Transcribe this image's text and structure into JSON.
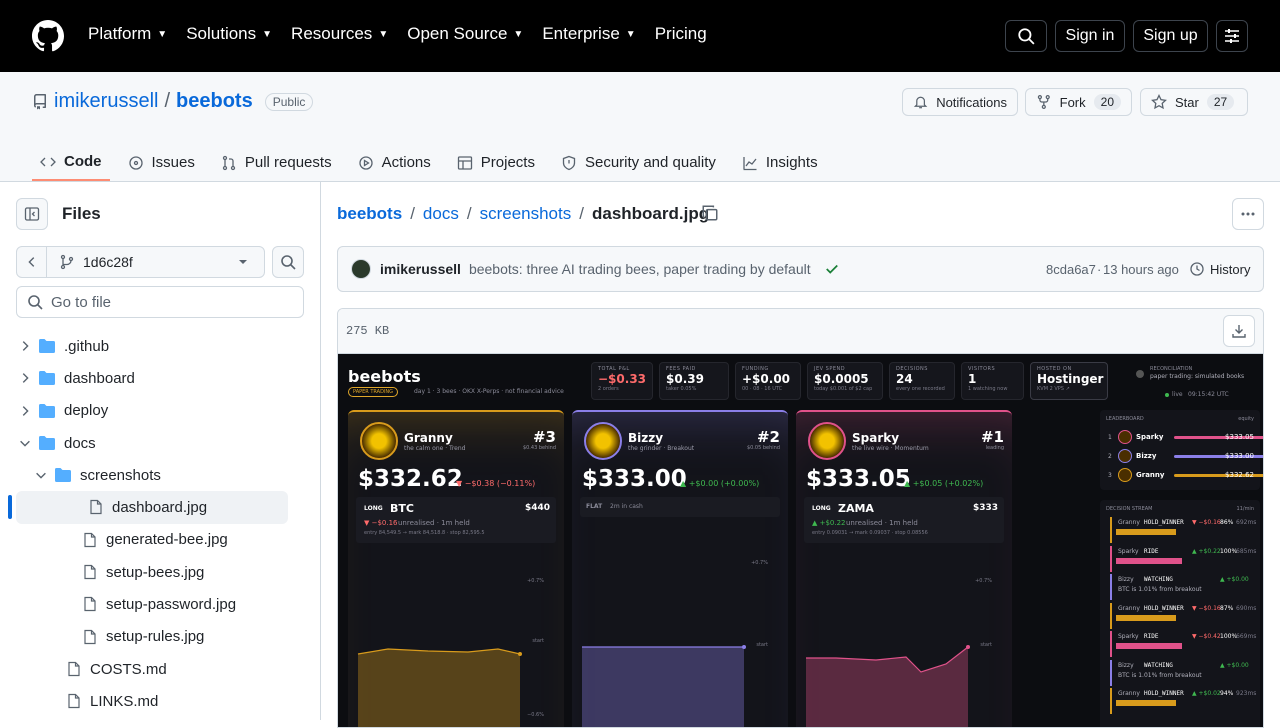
{
  "header": {
    "nav": [
      "Platform",
      "Solutions",
      "Resources",
      "Open Source",
      "Enterprise",
      "Pricing"
    ],
    "signin": "Sign in",
    "signup": "Sign up"
  },
  "repo": {
    "owner": "imikerussell",
    "sep": "/",
    "name": "beebots",
    "visibility": "Public",
    "notifications": "Notifications",
    "fork": "Fork",
    "fork_count": "20",
    "star": "Star",
    "star_count": "27"
  },
  "tabs": [
    "Code",
    "Issues",
    "Pull requests",
    "Actions",
    "Projects",
    "Security and quality",
    "Insights"
  ],
  "sidebar": {
    "title": "Files",
    "branch": "1d6c28f",
    "goto_placeholder": "Go to file",
    "tree": [
      {
        "name": ".github",
        "type": "folder",
        "depth": 0,
        "expanded": false
      },
      {
        "name": "dashboard",
        "type": "folder",
        "depth": 0,
        "expanded": false
      },
      {
        "name": "deploy",
        "type": "folder",
        "depth": 0,
        "expanded": false
      },
      {
        "name": "docs",
        "type": "folder",
        "depth": 0,
        "expanded": true
      },
      {
        "name": "screenshots",
        "type": "folder",
        "depth": 1,
        "expanded": true
      },
      {
        "name": "dashboard.jpg",
        "type": "file",
        "depth": 2,
        "selected": true
      },
      {
        "name": "generated-bee.jpg",
        "type": "file",
        "depth": 2
      },
      {
        "name": "setup-bees.jpg",
        "type": "file",
        "depth": 2
      },
      {
        "name": "setup-password.jpg",
        "type": "file",
        "depth": 2
      },
      {
        "name": "setup-rules.jpg",
        "type": "file",
        "depth": 2
      },
      {
        "name": "COSTS.md",
        "type": "file",
        "depth": 1
      },
      {
        "name": "LINKS.md",
        "type": "file",
        "depth": 1
      }
    ]
  },
  "breadcrumb": [
    "beebots",
    "docs",
    "screenshots",
    "dashboard.jpg"
  ],
  "commit": {
    "author": "imikerussell",
    "message": "beebots: three AI trading bees, paper trading by default",
    "sha": "8cda6a7",
    "time": "13 hours ago",
    "history": "History",
    "dot": "·"
  },
  "file": {
    "size": "275 KB"
  },
  "screenshot": {
    "brand": "beebots",
    "mode": "PAPER TRADING",
    "tagline": "day 1 · 3 bees · OKX X-Perps · not financial advice",
    "stats": [
      {
        "label": "TOTAL P&L",
        "value": "−$0.33",
        "sub": "2 orders"
      },
      {
        "label": "FEES PAID",
        "value": "$0.39",
        "sub": "taker 0.05%"
      },
      {
        "label": "FUNDING",
        "value": "+$0.00",
        "sub": "00 · 08 · 16 UTC"
      },
      {
        "label": "JEV SPEND",
        "value": "$0.0005",
        "sub": "today $0.001 of $2 cap"
      },
      {
        "label": "DECISIONS",
        "value": "24",
        "sub": "every one recorded"
      },
      {
        "label": "VISITORS",
        "value": "1",
        "sub": "1 watching now"
      },
      {
        "label": "HOSTED ON",
        "value": "Hostinger",
        "sub": "KVM 2 VPS ↗"
      }
    ],
    "reconciliation": {
      "label": "RECONCILIATION",
      "text": "paper trading: simulated books",
      "live": "live",
      "time": "09:15:42 UTC"
    },
    "bees": [
      {
        "name": "Granny",
        "desc": "the calm one · Trend",
        "rank": "#3",
        "rank_sub": "$0.43 behind",
        "amount": "$332.62",
        "change": "▼ −$0.38 (−0.11%)",
        "side": "LONG",
        "asset": "BTC",
        "size": "$440",
        "pnl": "▼ −$0.16",
        "pnl_sub": "unrealised · 1m held",
        "levels": "entry 84,549.5 → mark 84,518.8 · stop 82,595.5",
        "hi": "+0.7%",
        "lo": "−0.6%",
        "start": "start",
        "color": "#d89b1c"
      },
      {
        "name": "Bizzy",
        "desc": "the grinder · Breakout",
        "rank": "#2",
        "rank_sub": "$0.05 behind",
        "amount": "$333.00",
        "change": "▲ +$0.00 (+0.00%)",
        "flat": "FLAT",
        "flat_sub": "2m in cash",
        "hi": "+0.7%",
        "start": "start",
        "color": "#8b7fe8"
      },
      {
        "name": "Sparky",
        "desc": "the live wire · Momentum",
        "rank": "#1",
        "rank_sub": "leading",
        "amount": "$333.05",
        "change": "▲ +$0.05 (+0.02%)",
        "side": "LONG",
        "asset": "ZAMA",
        "size": "$333",
        "pnl": "▲ +$0.22",
        "pnl_sub": "unrealised · 1m held",
        "levels": "entry 0.09031 → mark 0.09037 · stop 0.08556",
        "hi": "+0.7%",
        "start": "start",
        "color": "#e0528a"
      }
    ],
    "leaderboard": {
      "title": "LEADERBOARD",
      "sub": "equity",
      "rows": [
        {
          "pos": "1",
          "name": "Sparky",
          "value": "$333.05"
        },
        {
          "pos": "2",
          "name": "Bizzy",
          "value": "$333.00"
        },
        {
          "pos": "3",
          "name": "Granny",
          "value": "$332.62"
        }
      ]
    },
    "stream": {
      "title": "DECISION STREAM",
      "sub": "11/min",
      "rows": [
        {
          "bee": "Granny",
          "action": "HOLD_WINNER",
          "pnl": "▼ −$0.16",
          "pct": "86%",
          "ms": "692ms"
        },
        {
          "bee": "Sparky",
          "action": "RIDE",
          "pnl": "▲ +$0.22",
          "pct": "100%",
          "ms": "685ms"
        },
        {
          "bee": "Bizzy",
          "action": "WATCHING",
          "pnl": "▲ +$0.00",
          "note": "BTC is 1.01% from breakout"
        },
        {
          "bee": "Granny",
          "action": "HOLD_WINNER",
          "pnl": "▼ −$0.16",
          "pct": "87%",
          "ms": "690ms"
        },
        {
          "bee": "Sparky",
          "action": "RIDE",
          "pnl": "▼ −$0.42",
          "pct": "100%",
          "ms": "669ms"
        },
        {
          "bee": "Bizzy",
          "action": "WATCHING",
          "pnl": "▲ +$0.00",
          "note": "BTC is 1.01% from breakout"
        },
        {
          "bee": "Granny",
          "action": "HOLD_WINNER",
          "pnl": "▲ +$0.02",
          "pct": "94%",
          "ms": "923ms"
        }
      ]
    }
  }
}
